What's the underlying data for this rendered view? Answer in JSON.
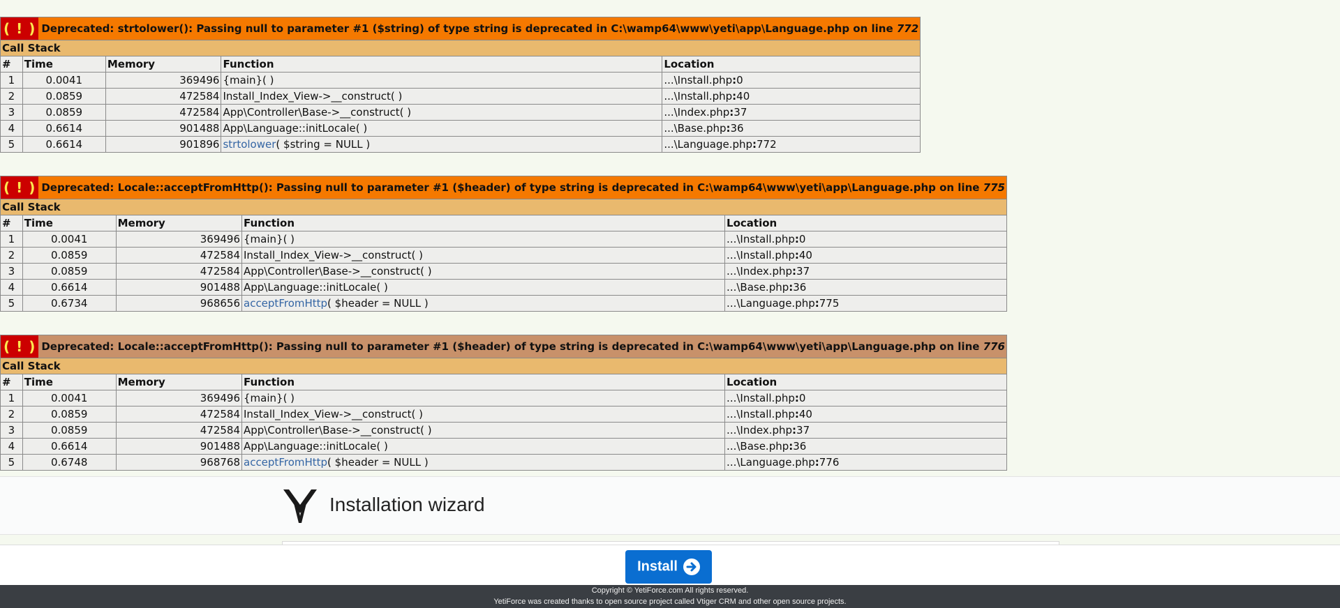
{
  "errors": [
    {
      "icon": "( ! )",
      "message": "Deprecated: strtolower(): Passing null to parameter #1 ($string) of type string is deprecated in C:\\wamp64\\www\\yeti\\app\\Language.php on line ",
      "line": "772",
      "callstack_label": "Call Stack",
      "headers": [
        "#",
        "Time",
        "Memory",
        "Function",
        "Location"
      ],
      "rows": [
        {
          "num": "1",
          "time": "0.0041",
          "memory": "369496",
          "fn": "{main}( )",
          "fn_link": "",
          "fn_args": "",
          "loc_file": "...\\Install.php",
          "loc_line": "0"
        },
        {
          "num": "2",
          "time": "0.0859",
          "memory": "472584",
          "fn": "Install_Index_View->__construct( )",
          "fn_link": "",
          "fn_args": "",
          "loc_file": "...\\Install.php",
          "loc_line": "40"
        },
        {
          "num": "3",
          "time": "0.0859",
          "memory": "472584",
          "fn": "App\\Controller\\Base->__construct( )",
          "fn_link": "",
          "fn_args": "",
          "loc_file": "...\\Index.php",
          "loc_line": "37"
        },
        {
          "num": "4",
          "time": "0.6614",
          "memory": "901488",
          "fn": "App\\Language::initLocale( )",
          "fn_link": "",
          "fn_args": "",
          "loc_file": "...\\Base.php",
          "loc_line": "36"
        },
        {
          "num": "5",
          "time": "0.6614",
          "memory": "901896",
          "fn": "",
          "fn_link": "strtolower",
          "fn_args": "( $string = NULL )",
          "loc_file": "...\\Language.php",
          "loc_line": "772"
        }
      ]
    },
    {
      "icon": "( ! )",
      "message": "Deprecated: Locale::acceptFromHttp(): Passing null to parameter #1 ($header) of type string is deprecated in C:\\wamp64\\www\\yeti\\app\\Language.php on line ",
      "line": "775",
      "callstack_label": "Call Stack",
      "headers": [
        "#",
        "Time",
        "Memory",
        "Function",
        "Location"
      ],
      "rows": [
        {
          "num": "1",
          "time": "0.0041",
          "memory": "369496",
          "fn": "{main}( )",
          "fn_link": "",
          "fn_args": "",
          "loc_file": "...\\Install.php",
          "loc_line": "0"
        },
        {
          "num": "2",
          "time": "0.0859",
          "memory": "472584",
          "fn": "Install_Index_View->__construct( )",
          "fn_link": "",
          "fn_args": "",
          "loc_file": "...\\Install.php",
          "loc_line": "40"
        },
        {
          "num": "3",
          "time": "0.0859",
          "memory": "472584",
          "fn": "App\\Controller\\Base->__construct( )",
          "fn_link": "",
          "fn_args": "",
          "loc_file": "...\\Index.php",
          "loc_line": "37"
        },
        {
          "num": "4",
          "time": "0.6614",
          "memory": "901488",
          "fn": "App\\Language::initLocale( )",
          "fn_link": "",
          "fn_args": "",
          "loc_file": "...\\Base.php",
          "loc_line": "36"
        },
        {
          "num": "5",
          "time": "0.6734",
          "memory": "968656",
          "fn": "",
          "fn_link": "acceptFromHttp",
          "fn_args": "( $header = NULL )",
          "loc_file": "...\\Language.php",
          "loc_line": "775"
        }
      ]
    },
    {
      "icon": "( ! )",
      "message": "Deprecated: Locale::acceptFromHttp(): Passing null to parameter #1 ($header) of type string is deprecated in C:\\wamp64\\www\\yeti\\app\\Language.php on line ",
      "line": "776",
      "callstack_label": "Call Stack",
      "headers": [
        "#",
        "Time",
        "Memory",
        "Function",
        "Location"
      ],
      "rows": [
        {
          "num": "1",
          "time": "0.0041",
          "memory": "369496",
          "fn": "{main}( )",
          "fn_link": "",
          "fn_args": "",
          "loc_file": "...\\Install.php",
          "loc_line": "0"
        },
        {
          "num": "2",
          "time": "0.0859",
          "memory": "472584",
          "fn": "Install_Index_View->__construct( )",
          "fn_link": "",
          "fn_args": "",
          "loc_file": "...\\Install.php",
          "loc_line": "40"
        },
        {
          "num": "3",
          "time": "0.0859",
          "memory": "472584",
          "fn": "App\\Controller\\Base->__construct( )",
          "fn_link": "",
          "fn_args": "",
          "loc_file": "...\\Index.php",
          "loc_line": "37"
        },
        {
          "num": "4",
          "time": "0.6614",
          "memory": "901488",
          "fn": "App\\Language::initLocale( )",
          "fn_link": "",
          "fn_args": "",
          "loc_file": "...\\Base.php",
          "loc_line": "36"
        },
        {
          "num": "5",
          "time": "0.6748",
          "memory": "968768",
          "fn": "",
          "fn_link": "acceptFromHttp",
          "fn_args": "( $header = NULL )",
          "loc_file": "...\\Language.php",
          "loc_line": "776"
        }
      ]
    }
  ],
  "wizard": {
    "title": "Installation wizard",
    "logo_icon": "yetiforce-logo-icon"
  },
  "actions": {
    "install_label": "Install",
    "install_icon": "arrow-circle-right-icon"
  },
  "footer": {
    "copyright": "Copyright © YetiForce.com All rights reserved.",
    "credits": "YetiForce was created thanks to open source project called Vtiger CRM and other open source projects."
  },
  "colors": {
    "error_header": "#f57900",
    "error_header_alt": "#c8916a",
    "callstack_bg": "#e9b96e",
    "row_bg": "#eeeeec",
    "bang_bg": "#cc0000",
    "bang_fg": "#fce94f",
    "button": "#0a6ed1",
    "footer_bg": "#3a3e43",
    "link": "#3465a4"
  }
}
